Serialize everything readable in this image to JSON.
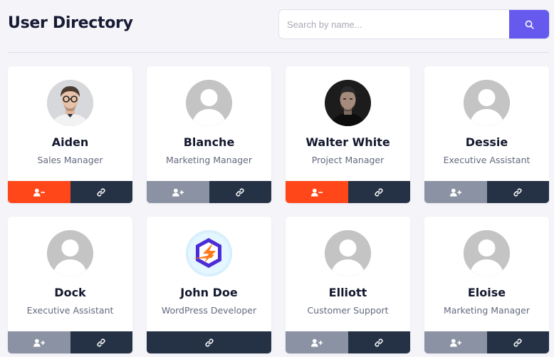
{
  "header": {
    "title": "User Directory",
    "search": {
      "placeholder": "Search by name...",
      "value": ""
    }
  },
  "colors": {
    "accent": "#6659ee",
    "remove": "#ff4719",
    "add": "#8b92a3",
    "link": "#253246",
    "placeholder_avatar": "#c4c4c4"
  },
  "icons": {
    "search": "search-icon",
    "remove": "user-minus-icon",
    "add": "user-plus-icon",
    "link": "link-icon"
  },
  "users": [
    {
      "name": "Aiden",
      "role": "Sales Manager",
      "avatar": "photo-man-glasses",
      "action": "remove"
    },
    {
      "name": "Blanche",
      "role": "Marketing Manager",
      "avatar": "placeholder",
      "action": "add"
    },
    {
      "name": "Walter White",
      "role": "Project Manager",
      "avatar": "photo-man-dark",
      "action": "remove"
    },
    {
      "name": "Dessie",
      "role": "Executive Assistant",
      "avatar": "placeholder",
      "action": "add"
    },
    {
      "name": "Dock",
      "role": "Executive Assistant",
      "avatar": "placeholder",
      "action": "add"
    },
    {
      "name": "John Doe",
      "role": "WordPress Developer",
      "avatar": "logo-bolt",
      "action": "none"
    },
    {
      "name": "Elliott",
      "role": "Customer Support",
      "avatar": "placeholder",
      "action": "add"
    },
    {
      "name": "Eloise",
      "role": "Marketing Manager",
      "avatar": "placeholder",
      "action": "add"
    }
  ]
}
